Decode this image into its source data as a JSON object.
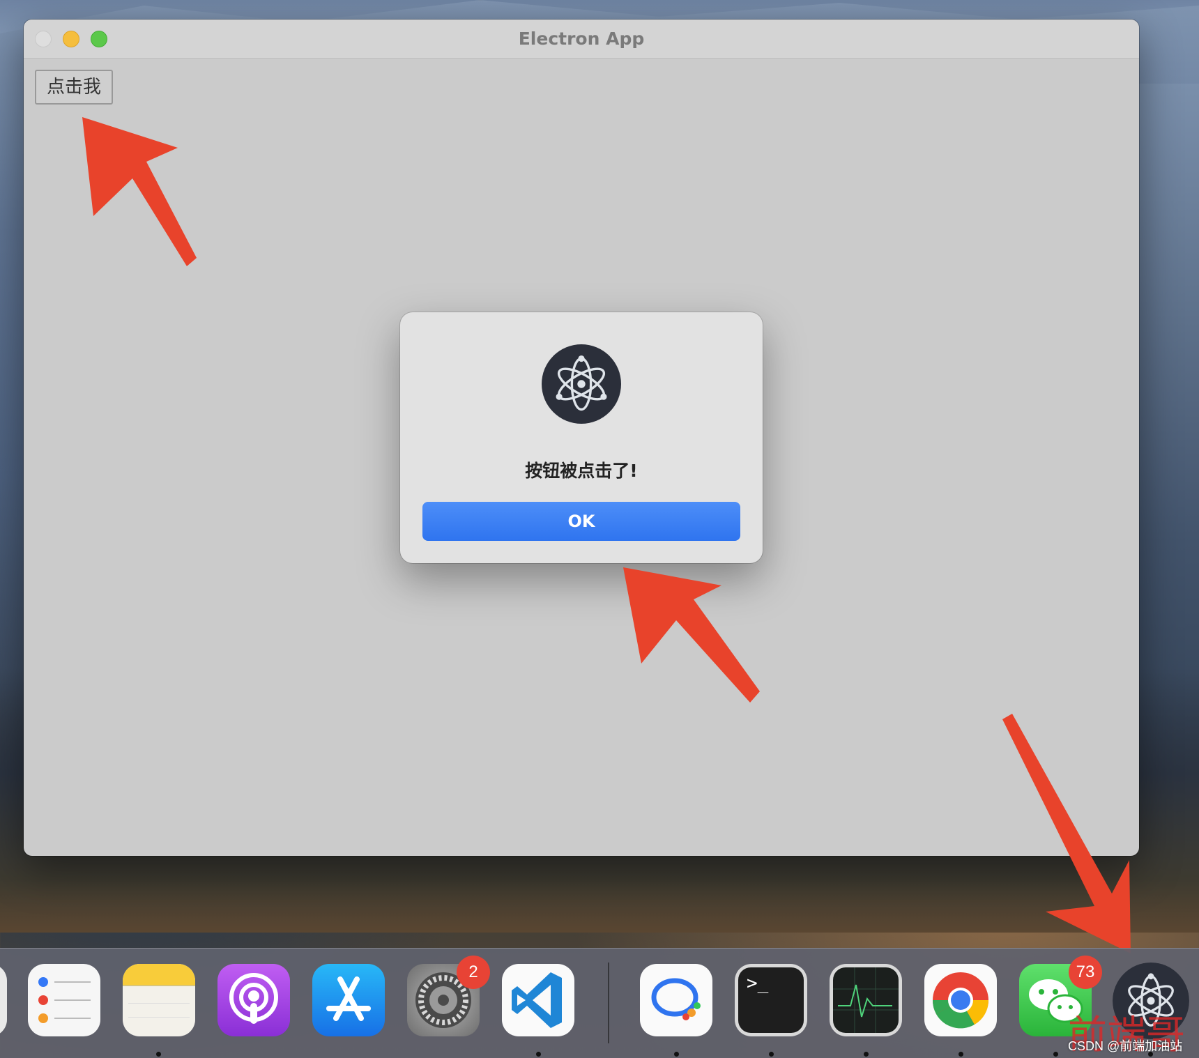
{
  "window": {
    "title": "Electron App",
    "click_button_label": "点击我"
  },
  "dialog": {
    "message": "按钮被点击了!",
    "ok_label": "OK"
  },
  "dock": {
    "items": [
      {
        "name": "Reminders",
        "icon": "reminders-icon"
      },
      {
        "name": "Notes",
        "icon": "notes-icon"
      },
      {
        "name": "Podcasts",
        "icon": "podcasts-icon"
      },
      {
        "name": "App Store",
        "icon": "app-store-icon"
      },
      {
        "name": "System Preferences",
        "icon": "system-preferences-icon",
        "badge": "2"
      },
      {
        "name": "Visual Studio Code",
        "icon": "vscode-icon"
      },
      {
        "name": "Feishu",
        "icon": "chat-bubble-icon"
      },
      {
        "name": "Terminal",
        "icon": "terminal-icon",
        "glyph": ">_"
      },
      {
        "name": "Activity Monitor",
        "icon": "activity-monitor-icon"
      },
      {
        "name": "Google Chrome",
        "icon": "chrome-icon"
      },
      {
        "name": "WeChat",
        "icon": "wechat-icon",
        "badge": "73"
      },
      {
        "name": "Electron",
        "icon": "electron-icon"
      }
    ]
  },
  "watermark": {
    "logo_text": "前端哥",
    "text": "CSDN @前端加油站"
  },
  "colors": {
    "accent_blue": "#2f74ef",
    "annotation_red": "#e8432b",
    "badge_red": "#e84335"
  }
}
